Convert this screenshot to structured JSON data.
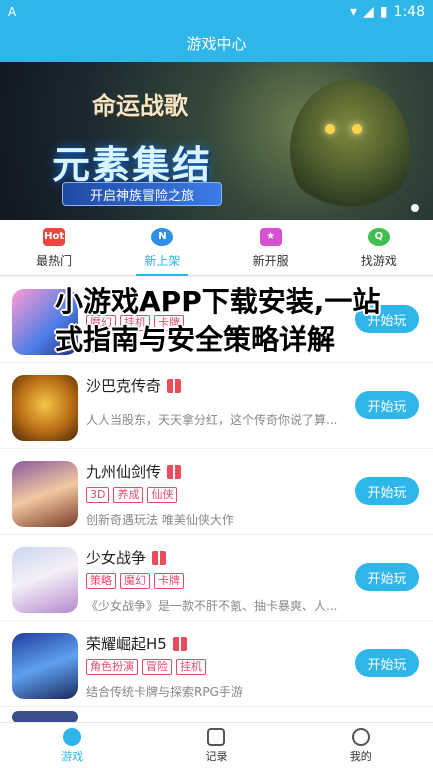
{
  "status_bar": {
    "left_icon": "A",
    "time": "1:48",
    "icons": [
      "wifi-icon",
      "signal-icon",
      "battery-icon"
    ]
  },
  "header": {
    "title": "游戏中心"
  },
  "banner": {
    "logo_text": "命运战歌",
    "headline": "元素集结",
    "slogan": "开启神族冒险之旅"
  },
  "tabs": [
    {
      "label": "最热门",
      "icon": "hot-icon",
      "badge": "Hot"
    },
    {
      "label": "新上架",
      "icon": "new-icon",
      "badge": "N"
    },
    {
      "label": "新开服",
      "icon": "server-icon",
      "badge": "★"
    },
    {
      "label": "找游戏",
      "icon": "search-icon",
      "badge": "Q"
    }
  ],
  "overlay": {
    "title": "小游戏APP下载安装,一站式指南与安全策略详解"
  },
  "games": [
    {
      "name": "",
      "tags": [
        "魔幻",
        "挂机",
        "卡牌"
      ],
      "desc": "魔",
      "play": "开始玩"
    },
    {
      "name": "沙巴克传奇",
      "tags": [],
      "desc": "人人当股东，天天拿分红，这个传奇你说了算...",
      "play": "开始玩"
    },
    {
      "name": "九州仙剑传",
      "tags": [
        "3D",
        "养成",
        "仙侠"
      ],
      "desc": "创新奇遇玩法 唯美仙侠大作",
      "play": "开始玩"
    },
    {
      "name": "少女战争",
      "tags": [
        "策略",
        "魔幻",
        "卡牌"
      ],
      "desc": "《少女战争》是一款不肝不氪、抽卡暴爽、人...",
      "play": "开始玩"
    },
    {
      "name": "荣耀崛起H5",
      "tags": [
        "角色扮演",
        "冒险",
        "挂机"
      ],
      "desc": "结合传统卡牌与探索RPG手游",
      "play": "开始玩"
    }
  ],
  "bottom_nav": [
    {
      "label": "游戏",
      "icon": "game-icon"
    },
    {
      "label": "记录",
      "icon": "record-icon"
    },
    {
      "label": "我的",
      "icon": "user-icon"
    }
  ]
}
